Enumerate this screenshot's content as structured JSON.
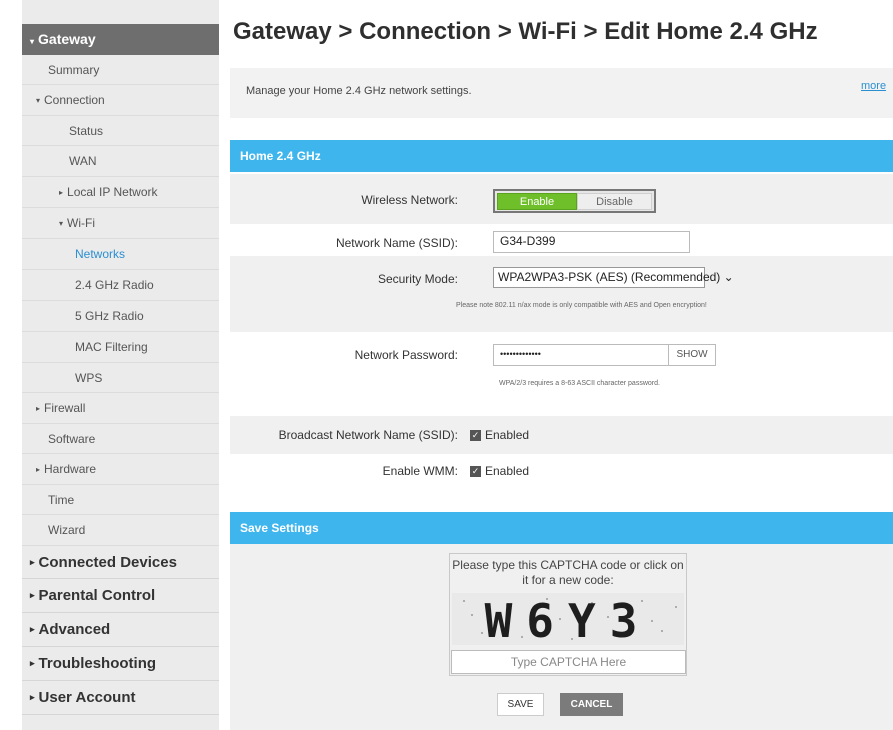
{
  "sidebar": {
    "header": "Gateway",
    "items": [
      {
        "label": "Summary"
      },
      {
        "label": "Connection"
      },
      {
        "label": "Status"
      },
      {
        "label": "WAN"
      },
      {
        "label": "Local IP Network"
      },
      {
        "label": "Wi-Fi"
      },
      {
        "label": "Networks"
      },
      {
        "label": "2.4 GHz Radio"
      },
      {
        "label": "5 GHz Radio"
      },
      {
        "label": "MAC Filtering"
      },
      {
        "label": "WPS"
      },
      {
        "label": "Firewall"
      },
      {
        "label": "Software"
      },
      {
        "label": "Hardware"
      },
      {
        "label": "Time"
      },
      {
        "label": "Wizard"
      },
      {
        "label": "Connected Devices"
      },
      {
        "label": "Parental Control"
      },
      {
        "label": "Advanced"
      },
      {
        "label": "Troubleshooting"
      },
      {
        "label": "User Account"
      }
    ]
  },
  "page": {
    "title": "Gateway > Connection > Wi-Fi > Edit Home 2.4 GHz",
    "intro": "Manage your Home 2.4 GHz network settings.",
    "more": "more"
  },
  "form": {
    "section_title": "Home 2.4 GHz",
    "wireless_label": "Wireless Network:",
    "enable_label": "Enable",
    "disable_label": "Disable",
    "ssid_label": "Network Name (SSID):",
    "ssid_value": "G34-D399",
    "security_label": "Security Mode:",
    "security_value": "WPA2WPA3-PSK (AES) (Recommended)",
    "security_note": "Please note 802.11 n/ax mode is only compatible with AES and Open encryption!",
    "password_label": "Network Password:",
    "password_value": "•••••••••••••",
    "show_label": "SHOW",
    "password_note": "WPA/2/3 requires a 8-63 ASCII character password.",
    "broadcast_label": "Broadcast Network Name (SSID):",
    "broadcast_value": "Enabled",
    "wmm_label": "Enable WMM:",
    "wmm_value": "Enabled"
  },
  "save": {
    "section_title": "Save Settings",
    "captcha_prompt": "Please type this CAPTCHA code or click on it for a new code:",
    "captcha_code": "W6Y3",
    "captcha_placeholder": "Type CAPTCHA Here",
    "save_label": "SAVE",
    "cancel_label": "CANCEL"
  },
  "colors": {
    "accent_blue": "#3fb5ee",
    "enable_green": "#6fbf2a",
    "sidebar_header": "#6e6e6e"
  }
}
